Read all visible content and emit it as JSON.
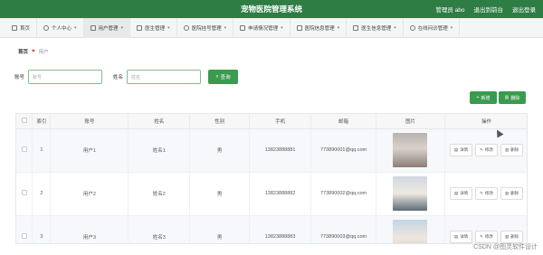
{
  "header": {
    "title": "宠物医院管理系统",
    "user_label": "管理员 abo",
    "back_label": "退出到前台",
    "logout_label": "退出登录"
  },
  "nav": {
    "items": [
      {
        "label": "首页",
        "icon": "home-icon"
      },
      {
        "label": "个人中心",
        "icon": "user-icon"
      },
      {
        "label": "用户管理",
        "icon": "doc-icon"
      },
      {
        "label": "医生管理",
        "icon": "doc-icon"
      },
      {
        "label": "医院挂号管理",
        "icon": "circle-icon"
      },
      {
        "label": "申请情况管理",
        "icon": "grid-icon"
      },
      {
        "label": "医院信息管理",
        "icon": "grid-icon"
      },
      {
        "label": "医生信息管理",
        "icon": "doc-icon"
      },
      {
        "label": "在线问诊管理",
        "icon": "circle-icon"
      }
    ]
  },
  "breadcrumb": {
    "home": "首页",
    "current": "用户"
  },
  "search": {
    "account_label": "账号",
    "account_placeholder": "账号",
    "name_label": "姓名",
    "name_placeholder": "姓名",
    "query_label": "查询"
  },
  "toolbar": {
    "add_label": "新增",
    "delete_label": "删除"
  },
  "table": {
    "headers": [
      "索引",
      "账号",
      "姓名",
      "性别",
      "手机",
      "邮箱",
      "图片",
      "操作"
    ],
    "rows": [
      {
        "index": "1",
        "account": "用户1",
        "name": "姓名1",
        "gender": "男",
        "phone": "13823888881",
        "email": "773890001@qq.com"
      },
      {
        "index": "2",
        "account": "用户2",
        "name": "姓名2",
        "gender": "男",
        "phone": "13823888882",
        "email": "773890002@qq.com"
      },
      {
        "index": "3",
        "account": "用户3",
        "name": "姓名3",
        "gender": "男",
        "phone": "13823888883",
        "email": "773890003@qq.com"
      }
    ],
    "row_actions": {
      "detail": "详情",
      "edit": "修改",
      "delete": "删除"
    }
  },
  "watermark": "CSDN @图灵软件设计"
}
